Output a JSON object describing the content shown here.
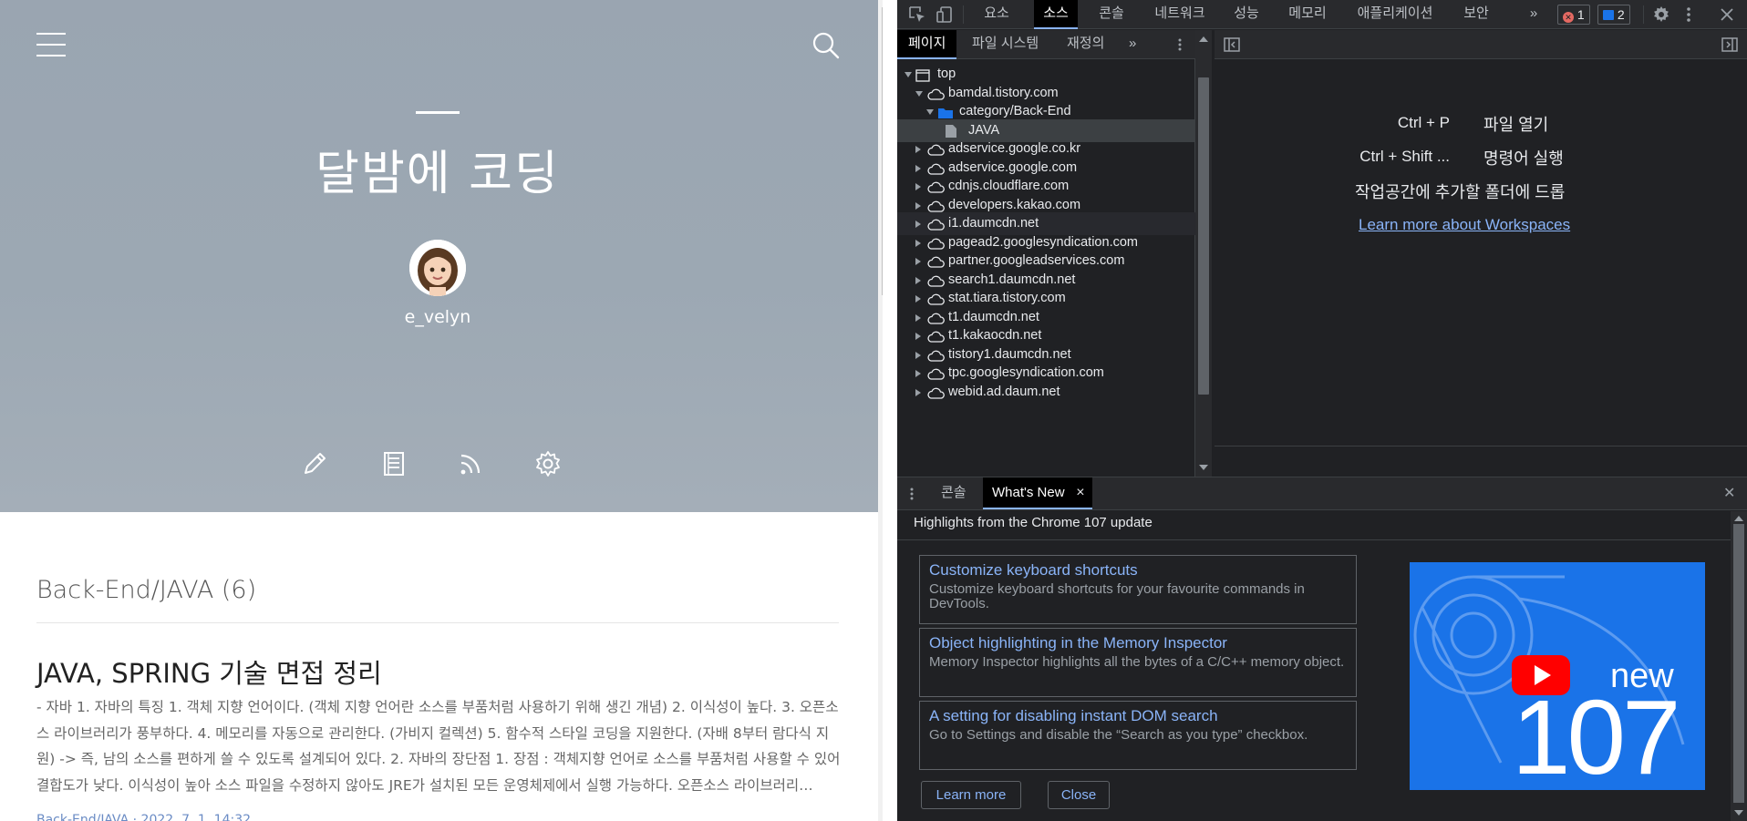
{
  "blog": {
    "title": "달밤에 코딩",
    "username": "e_velyn",
    "category_heading": "Back-End/JAVA (6)",
    "post": {
      "title": "JAVA, SPRING 기술 면접 정리",
      "excerpt_lines": [
        "- 자바 1. 자바의 특징 1. 객체 지향 언어이다. (객체 지향 언어란 소스를 부품처럼 사용하기 위해 생긴 개념) 2. 이식성이 높다. 3. 오픈소",
        "스 라이브러리가 풍부하다. 4. 메모리를 자동으로 관리한다. (가비지 컬렉션) 5. 함수적 스타일 코딩을 지원한다. (자배 8부터 람다식 지",
        "원) -> 즉, 남의 소스를 편하게 쓸 수 있도록 설계되어 있다. 2. 자바의 장단점 1. 장점 : 객체지향 언어로 소스를 부품처럼 사용할 수 있어",
        "결합도가 낮다. 이식성이 높아 소스 파일을 수정하지 않아도 JRE가 설치된 모든 운영체제에서 실행 가능하다. 오픈소스 라이브러리…"
      ],
      "meta": "Back-End/JAVA · 2022. 7. 1. 14:32"
    },
    "icons": [
      "menu-icon",
      "search-icon",
      "pencil-icon",
      "book-icon",
      "rss-icon",
      "gear-icon"
    ]
  },
  "devtools": {
    "tabs": [
      "요소",
      "소스",
      "콘솔",
      "네트워크",
      "성능",
      "메모리",
      "애플리케이션",
      "보안"
    ],
    "active_tab": "소스",
    "more": "»",
    "errors": "1",
    "messages": "2",
    "navigator": {
      "tabs": [
        "페이지",
        "파일 시스템",
        "재정의"
      ],
      "more": "»",
      "tree": [
        {
          "label": "top",
          "depth": 0,
          "icon": "frame-icon",
          "expanded": true
        },
        {
          "label": "bamdal.tistory.com",
          "depth": 1,
          "icon": "cloud-icon",
          "expanded": true
        },
        {
          "label": "category/Back-End",
          "depth": 2,
          "icon": "folder-icon",
          "expanded": true
        },
        {
          "label": "JAVA",
          "depth": 3,
          "icon": "file-icon",
          "selected": true
        },
        {
          "label": "adservice.google.co.kr",
          "depth": 1,
          "icon": "cloud-icon"
        },
        {
          "label": "adservice.google.com",
          "depth": 1,
          "icon": "cloud-icon"
        },
        {
          "label": "cdnjs.cloudflare.com",
          "depth": 1,
          "icon": "cloud-icon"
        },
        {
          "label": "developers.kakao.com",
          "depth": 1,
          "icon": "cloud-icon"
        },
        {
          "label": "i1.daumcdn.net",
          "depth": 1,
          "icon": "cloud-icon",
          "hover": true
        },
        {
          "label": "pagead2.googlesyndication.com",
          "depth": 1,
          "icon": "cloud-icon"
        },
        {
          "label": "partner.googleadservices.com",
          "depth": 1,
          "icon": "cloud-icon"
        },
        {
          "label": "search1.daumcdn.net",
          "depth": 1,
          "icon": "cloud-icon"
        },
        {
          "label": "stat.tiara.tistory.com",
          "depth": 1,
          "icon": "cloud-icon"
        },
        {
          "label": "t1.daumcdn.net",
          "depth": 1,
          "icon": "cloud-icon"
        },
        {
          "label": "t1.kakaocdn.net",
          "depth": 1,
          "icon": "cloud-icon"
        },
        {
          "label": "tistory1.daumcdn.net",
          "depth": 1,
          "icon": "cloud-icon"
        },
        {
          "label": "tpc.googlesyndication.com",
          "depth": 1,
          "icon": "cloud-icon"
        },
        {
          "label": "webid.ad.daum.net",
          "depth": 1,
          "icon": "cloud-icon"
        }
      ]
    },
    "editor": {
      "shortcuts": [
        {
          "keys": "Ctrl + P",
          "action": "파일 열기"
        },
        {
          "keys": "Ctrl + Shift ...",
          "action": "명령어 실행"
        }
      ],
      "drop_hint": "작업공간에 추가할 폴더에 드롭",
      "workspaces_link": "Learn more about Workspaces"
    },
    "drawer": {
      "tabs": [
        "콘솔",
        "What's New"
      ],
      "active_tab": "What's New",
      "close_tab": "×",
      "close_drawer": "✕",
      "heading": "Highlights from the Chrome 107 update",
      "features": [
        {
          "title": "Customize keyboard shortcuts",
          "desc": "Customize keyboard shortcuts for your favourite commands in DevTools."
        },
        {
          "title": "Object highlighting in the Memory Inspector",
          "desc": "Memory Inspector highlights all the bytes of a C/C++ memory object."
        },
        {
          "title": "A setting for disabling instant DOM search",
          "desc": "Go to Settings and disable the “Search as you type” checkbox."
        }
      ],
      "promo": {
        "word": "new",
        "version": "107"
      },
      "learn_more": "Learn more",
      "close": "Close"
    },
    "colors": {
      "accent": "#8ab4f8",
      "error": "#e46962",
      "info": "#1a73e8",
      "promo": "#1a73e8"
    }
  }
}
